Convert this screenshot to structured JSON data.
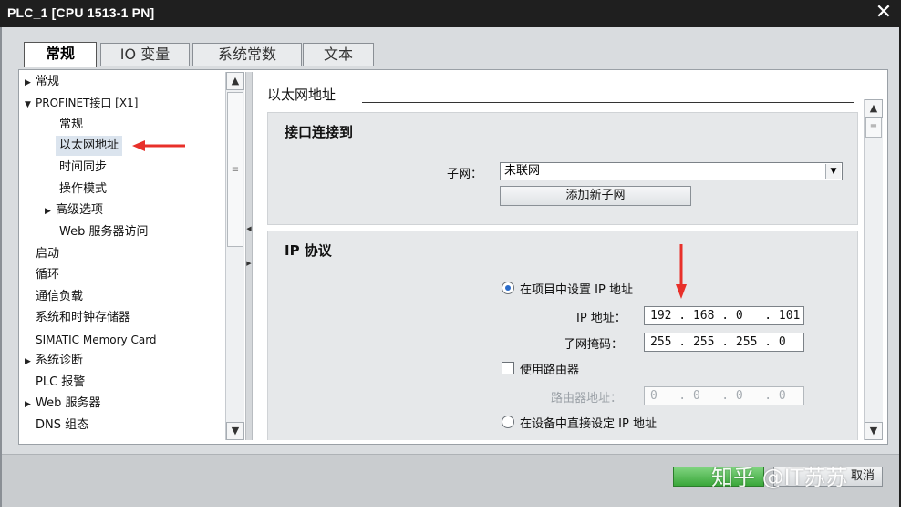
{
  "window": {
    "title": "PLC_1 [CPU 1513-1 PN]",
    "close_glyph": "✕"
  },
  "tabs": [
    {
      "label": "常规"
    },
    {
      "label": "IO 变量"
    },
    {
      "label": "系统常数"
    },
    {
      "label": "文本"
    }
  ],
  "tree": [
    {
      "label": "常规",
      "arrow": "▶"
    },
    {
      "label": "PROFINET接口 [X1]",
      "arrow": "▼"
    },
    {
      "label": "常规",
      "arrow": ""
    },
    {
      "label": "以太网地址",
      "arrow": ""
    },
    {
      "label": "时间同步",
      "arrow": ""
    },
    {
      "label": "操作模式",
      "arrow": ""
    },
    {
      "label": "高级选项",
      "arrow": "▶"
    },
    {
      "label": "Web 服务器访问",
      "arrow": ""
    },
    {
      "label": "启动",
      "arrow": ""
    },
    {
      "label": "循环",
      "arrow": ""
    },
    {
      "label": "通信负载",
      "arrow": ""
    },
    {
      "label": "系统和时钟存储器",
      "arrow": ""
    },
    {
      "label": "SIMATIC Memory Card",
      "arrow": ""
    },
    {
      "label": "系统诊断",
      "arrow": "▶"
    },
    {
      "label": "PLC 报警",
      "arrow": ""
    },
    {
      "label": "Web 服务器",
      "arrow": "▶"
    },
    {
      "label": "DNS 组态",
      "arrow": ""
    }
  ],
  "main": {
    "section_title": "以太网地址",
    "interface_box": {
      "title": "接口连接到",
      "subnet_label": "子网：",
      "subnet_value": "未联网",
      "add_subnet_button": "添加新子网"
    },
    "ip_box": {
      "title": "IP 协议",
      "radio_project": "在项目中设置 IP 地址",
      "ip_label": "IP 地址：",
      "ip_value": "192 . 168 . 0   . 101",
      "mask_label": "子网掩码：",
      "mask_value": "255 . 255 . 255 . 0",
      "use_router_label": "使用路由器",
      "router_label": "路由器地址：",
      "router_value": "0   . 0   . 0   . 0",
      "radio_device": "在设备中直接设定 IP 地址"
    }
  },
  "footer": {
    "cancel_label": "取消",
    "watermark": "知乎 @IT苏苏"
  },
  "colors": {
    "titlebar_bg": "#1f1f1f",
    "annotation_red": "#e8302a",
    "ok_green": "#3aa73a",
    "selection_bg": "#dbe4ee"
  }
}
